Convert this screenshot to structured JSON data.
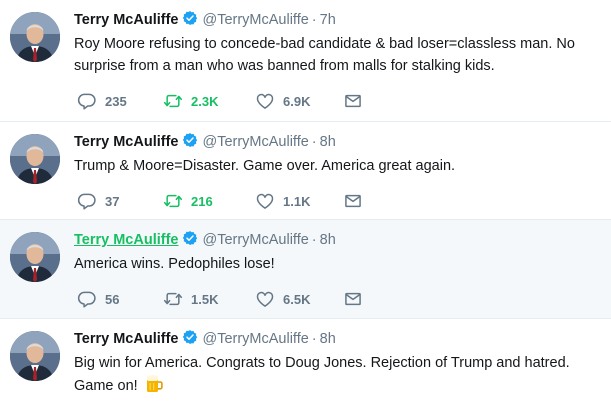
{
  "tweets": [
    {
      "name": "Terry McAuliffe",
      "handle": "@TerryMcAuliffe",
      "time": "7h",
      "text": "Roy Moore refusing to concede-bad candidate & bad loser=classless man. No surprise from a man who was banned from malls for stalking kids.",
      "replies": "235",
      "retweets": "2.3K",
      "likes": "6.9K"
    },
    {
      "name": "Terry McAuliffe",
      "handle": "@TerryMcAuliffe",
      "time": "8h",
      "text": "Trump & Moore=Disaster.  Game over.  America great again.",
      "replies": "37",
      "retweets": "216",
      "likes": "1.1K"
    },
    {
      "name": "Terry McAuliffe",
      "handle": "@TerryMcAuliffe",
      "time": "8h",
      "text": "America wins.  Pedophiles lose!",
      "replies": "56",
      "retweets": "1.5K",
      "likes": "6.5K"
    },
    {
      "name": "Terry McAuliffe",
      "handle": "@TerryMcAuliffe",
      "time": "8h",
      "text": "Big win for America. Congrats to Doug Jones.  Rejection of Trump and hatred. Game on!",
      "emoji": "beer-mug-emoji"
    }
  ],
  "separator": "·",
  "colors": {
    "name_hover": "#17bf63",
    "retweet_active": "#17bf63",
    "muted": "#657786",
    "verified": "#1da1f2",
    "divider": "#e6ecf0"
  },
  "icons": [
    "verified-badge-icon",
    "reply-icon",
    "retweet-icon",
    "like-icon",
    "direct-message-icon"
  ]
}
